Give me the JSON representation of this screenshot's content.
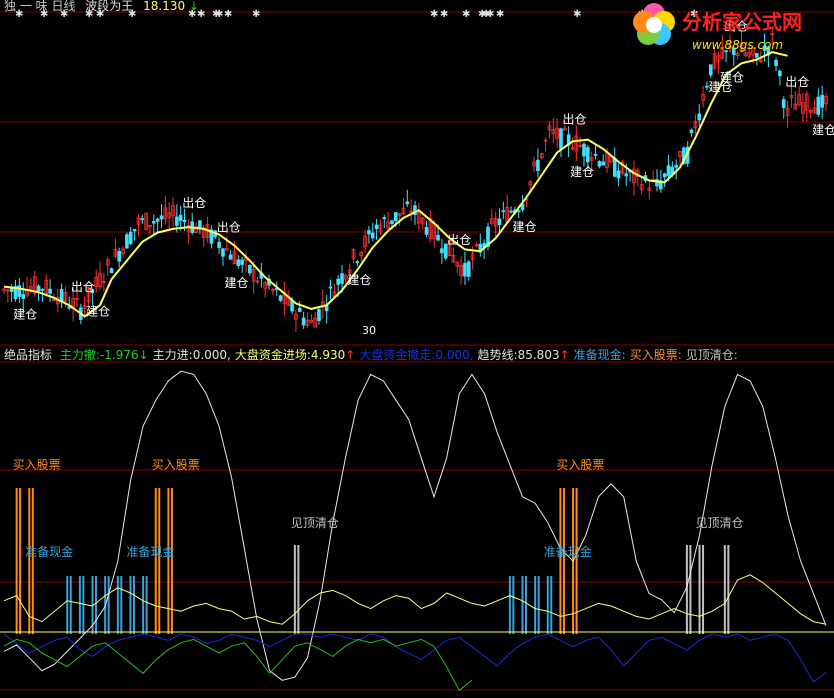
{
  "colors": {
    "background": "#000000",
    "up": "#ff3030",
    "down": "#40e0ff",
    "ma": "#ffff60",
    "grid": "#8b0000",
    "title": "#c8c8c8",
    "buy_bar": "#ff8c1a",
    "cash_bar": "#3aa0d8",
    "top_bar": "#c0c0c0",
    "white_line": "#e8e8e8",
    "yellow_line": "#ffff80",
    "green_line": "#20c020",
    "blue_line": "#1e2ad8",
    "zero_line": "#ffff60"
  },
  "header": {
    "title": "独 一 味 日线",
    "indicator": "波段为王",
    "value": "18.130",
    "arrow": "↓"
  },
  "logo": {
    "text": "分析家公式网",
    "url": "www.88gs.com"
  },
  "sub_header": {
    "name": "绝品指标",
    "items": [
      {
        "label": "主力撤:",
        "value": "-1.976",
        "arrow": "↓",
        "color": "#20d020"
      },
      {
        "label": "主力进:",
        "value": "0.000,",
        "arrow": "",
        "color": "#e0e0e0"
      },
      {
        "label": "大盘资金进场:",
        "value": "4.930",
        "arrow": "↑",
        "color": "#ffff60"
      },
      {
        "label": "大盘资金撤走:",
        "value": "0.000,",
        "arrow": "",
        "color": "#2030e0"
      },
      {
        "label": "趋势线:",
        "value": "85.803",
        "arrow": "↑",
        "color": "#e0e0e0"
      },
      {
        "label": "准备现金:",
        "value": "",
        "arrow": "",
        "color": "#3aa0d8"
      },
      {
        "label": "买入股票:",
        "value": "",
        "arrow": "",
        "color": "#ff9020"
      },
      {
        "label": "见顶清仓:",
        "value": "",
        "arrow": "",
        "color": "#c0c0c0"
      }
    ]
  },
  "chart_data": [
    {
      "type": "candlestick",
      "title": "独 一 味 日线",
      "note": "price series with 波段为王 moving average; index-based x-axis",
      "ma_name": "波段为王",
      "ma_last": 18.13,
      "ma_points": [
        [
          0,
          11.9
        ],
        [
          4,
          11.85
        ],
        [
          9,
          11.75
        ],
        [
          13,
          11.6
        ],
        [
          17,
          11.4
        ],
        [
          21,
          11.1
        ],
        [
          25,
          11.4
        ],
        [
          28,
          12.1
        ],
        [
          32,
          12.6
        ],
        [
          36,
          13.1
        ],
        [
          40,
          13.35
        ],
        [
          44,
          13.45
        ],
        [
          48,
          13.5
        ],
        [
          52,
          13.45
        ],
        [
          56,
          13.3
        ],
        [
          60,
          13.0
        ],
        [
          64,
          12.6
        ],
        [
          68,
          12.15
        ],
        [
          72,
          11.8
        ],
        [
          76,
          11.45
        ],
        [
          80,
          11.3
        ],
        [
          84,
          11.4
        ],
        [
          88,
          11.8
        ],
        [
          92,
          12.35
        ],
        [
          96,
          12.95
        ],
        [
          100,
          13.4
        ],
        [
          104,
          13.75
        ],
        [
          108,
          13.95
        ],
        [
          112,
          13.6
        ],
        [
          116,
          13.2
        ],
        [
          120,
          12.9
        ],
        [
          124,
          12.85
        ],
        [
          128,
          13.2
        ],
        [
          132,
          13.75
        ],
        [
          136,
          14.3
        ],
        [
          140,
          14.9
        ],
        [
          144,
          15.5
        ],
        [
          148,
          15.8
        ],
        [
          152,
          15.85
        ],
        [
          156,
          15.6
        ],
        [
          160,
          15.25
        ],
        [
          164,
          14.95
        ],
        [
          168,
          14.75
        ],
        [
          172,
          14.7
        ],
        [
          176,
          15.1
        ],
        [
          180,
          15.9
        ],
        [
          184,
          16.8
        ],
        [
          188,
          17.6
        ],
        [
          192,
          17.9
        ],
        [
          196,
          18.0
        ],
        [
          200,
          18.2
        ],
        [
          204,
          18.1
        ]
      ],
      "price_extremes": [
        [
          0,
          11.8,
          12.1
        ],
        [
          10,
          11.9,
          11.4
        ],
        [
          20,
          11.3,
          11.0
        ],
        [
          27,
          12.4,
          13.0
        ],
        [
          35,
          13.6,
          13.9
        ],
        [
          45,
          13.8,
          13.3
        ],
        [
          55,
          13.2,
          12.8
        ],
        [
          62,
          12.5,
          12.2
        ],
        [
          72,
          11.6,
          11.2
        ],
        [
          80,
          10.9,
          11.2
        ],
        [
          88,
          12.2,
          12.8
        ],
        [
          97,
          13.5,
          14.0
        ],
        [
          106,
          14.0,
          13.8
        ],
        [
          114,
          13.1,
          12.7
        ],
        [
          120,
          12.3,
          12.6
        ],
        [
          128,
          13.6,
          14.2
        ],
        [
          135,
          14.2,
          14.8
        ],
        [
          142,
          16.0,
          17.0
        ],
        [
          148,
          15.8,
          16.2
        ],
        [
          156,
          15.3,
          15.8
        ],
        [
          164,
          14.8,
          14.5
        ],
        [
          170,
          14.6,
          14.9
        ],
        [
          178,
          15.5,
          16.8
        ],
        [
          184,
          17.8,
          18.5
        ],
        [
          190,
          18.3,
          19.0
        ],
        [
          196,
          18.0,
          18.6
        ],
        [
          200,
          18.5,
          17.9
        ],
        [
          204,
          16.5,
          16.8
        ]
      ],
      "signals": [
        {
          "label": "出仓",
          "index": 20
        },
        {
          "label": "建仓",
          "index": 5
        },
        {
          "label": "建仓",
          "index": 24
        },
        {
          "label": "出仓",
          "index": 49
        },
        {
          "label": "出仓",
          "index": 58
        },
        {
          "label": "建仓",
          "index": 60
        },
        {
          "label": "建仓",
          "index": 92
        },
        {
          "label": "出仓",
          "index": 118
        },
        {
          "label": "建仓",
          "index": 135
        },
        {
          "label": "出仓",
          "index": 148
        },
        {
          "label": "建仓",
          "index": 150
        },
        {
          "label": "建仓",
          "index": 186
        },
        {
          "label": "建仓",
          "index": 189
        },
        {
          "label": "出仓",
          "index": 190
        },
        {
          "label": "出仓",
          "index": 206
        },
        {
          "label": "建仓",
          "index": 213
        }
      ],
      "price_label": "30"
    },
    {
      "type": "line",
      "title": "绝品指标",
      "series": [
        {
          "name": "趋势线",
          "values": [
            12,
            14,
            10,
            6,
            8,
            12,
            16,
            20,
            26,
            40,
            65,
            82,
            90,
            96,
            99,
            98,
            92,
            82,
            66,
            44,
            22,
            6,
            3,
            4,
            10,
            28,
            52,
            72,
            90,
            98,
            96,
            90,
            84,
            72,
            60,
            72,
            92,
            98,
            92,
            80,
            70,
            60,
            58,
            52,
            44,
            40,
            48,
            60,
            64,
            60,
            40,
            30,
            28,
            24,
            32,
            48,
            70,
            88,
            98,
            96,
            88,
            72,
            54,
            40,
            30,
            20
          ]
        },
        {
          "name": "主力进",
          "values": [
            24,
            28,
            12,
            8,
            16,
            24,
            22,
            20,
            28,
            34,
            30,
            24,
            20,
            18,
            16,
            20,
            22,
            18,
            16,
            10,
            12,
            8,
            6,
            14,
            24,
            30,
            32,
            28,
            22,
            18,
            24,
            28,
            26,
            18,
            22,
            30,
            26,
            22,
            20,
            24,
            28,
            24,
            18,
            16,
            12,
            14,
            18,
            22,
            20,
            16,
            12,
            10,
            14,
            18,
            14,
            12,
            16,
            22,
            40,
            44,
            38,
            30,
            22,
            14,
            8,
            6
          ]
        },
        {
          "name": "主力撤",
          "values": [
            0,
            -6,
            -12,
            -8,
            -4,
            -2,
            -10,
            -14,
            -8,
            -4,
            -2,
            0,
            -2,
            -4,
            0,
            -2,
            -6,
            -4,
            0,
            -2,
            -4,
            -8,
            -4,
            0,
            0,
            -2,
            0,
            -2,
            -4,
            0,
            -2,
            -8,
            -12,
            -16,
            -10,
            -4,
            -2,
            -8,
            -14,
            -20,
            -12,
            -6,
            -2,
            0,
            -4,
            -8,
            -4,
            -2,
            -10,
            -20,
            -12,
            -4,
            -2,
            -6,
            -10,
            -4,
            0,
            -2,
            0,
            -4,
            -2,
            0,
            -4,
            -16,
            -30,
            -24
          ]
        }
      ],
      "signals": [
        {
          "label": "买入股票",
          "positions": [
            1,
            2,
            12,
            13,
            44,
            45
          ]
        },
        {
          "label": "准备现金",
          "positions": [
            5,
            6,
            7,
            8,
            9,
            10,
            11,
            40,
            41,
            42,
            43
          ]
        },
        {
          "label": "见顶清仓",
          "positions": [
            23,
            54,
            55,
            57,
            68,
            69,
            70,
            72,
            73,
            74,
            75,
            94,
            95,
            96,
            97,
            98,
            99,
            102
          ]
        }
      ],
      "signal_labels": [
        {
          "label": "买入股票",
          "index": 1
        },
        {
          "label": "买入股票",
          "index": 12
        },
        {
          "label": "买入股票",
          "index": 44
        },
        {
          "label": "准备现金",
          "index": 2
        },
        {
          "label": "准备现金",
          "index": 10
        },
        {
          "label": "准备现金",
          "index": 43
        },
        {
          "label": "见顶清仓",
          "index": 23
        },
        {
          "label": "见顶清仓",
          "index": 55
        },
        {
          "label": "见顶清仓",
          "index": 70
        },
        {
          "label": "见顶清仓",
          "index": 76
        },
        {
          "label": "见顶清仓",
          "index": 97
        },
        {
          "label": "见顶清",
          "index": 105
        }
      ]
    }
  ]
}
